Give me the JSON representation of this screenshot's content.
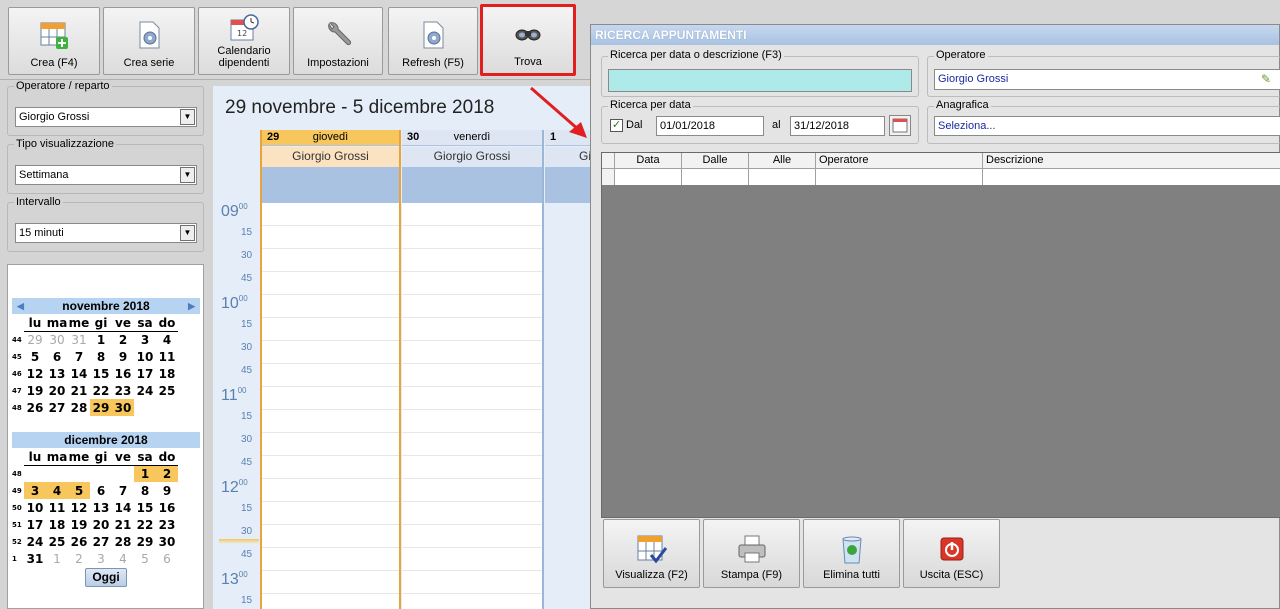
{
  "toolbar": {
    "buttons": [
      {
        "label": "Crea (F4)",
        "icon": "calendar-add-icon"
      },
      {
        "label": "Crea serie",
        "icon": "series-gear-icon"
      },
      {
        "label": "Calendario dipendenti",
        "icon": "calendar-clock-icon"
      },
      {
        "label": "Impostazioni",
        "icon": "wrench-icon"
      },
      {
        "label": "Refresh (F5)",
        "icon": "refresh-gear-icon"
      },
      {
        "label": "Trova",
        "icon": "binoculars-icon"
      }
    ]
  },
  "left": {
    "operator_label": "Operatore / reparto",
    "operator_value": "Giorgio Grossi",
    "view_label": "Tipo visualizzazione",
    "view_value": "Settimana",
    "interval_label": "Intervallo",
    "interval_value": "15 minuti",
    "today_label": "Oggi"
  },
  "minical": {
    "weekday_headers": [
      "lu",
      "ma",
      "me",
      "gi",
      "ve",
      "sa",
      "do"
    ],
    "november": {
      "title": "novembre 2018",
      "weeks": [
        {
          "wk": "44",
          "days": [
            "29",
            "30",
            "31",
            "1",
            "2",
            "3",
            "4"
          ]
        },
        {
          "wk": "45",
          "days": [
            "5",
            "6",
            "7",
            "8",
            "9",
            "10",
            "11"
          ]
        },
        {
          "wk": "46",
          "days": [
            "12",
            "13",
            "14",
            "15",
            "16",
            "17",
            "18"
          ]
        },
        {
          "wk": "47",
          "days": [
            "19",
            "20",
            "21",
            "22",
            "23",
            "24",
            "25"
          ]
        },
        {
          "wk": "48",
          "days": [
            "26",
            "27",
            "28",
            "29",
            "30",
            "",
            ""
          ]
        }
      ]
    },
    "december": {
      "title": "dicembre 2018",
      "weeks": [
        {
          "wk": "48",
          "days": [
            "",
            "",
            "",
            "",
            "",
            "1",
            "2"
          ]
        },
        {
          "wk": "49",
          "days": [
            "3",
            "4",
            "5",
            "6",
            "7",
            "8",
            "9"
          ]
        },
        {
          "wk": "50",
          "days": [
            "10",
            "11",
            "12",
            "13",
            "14",
            "15",
            "16"
          ]
        },
        {
          "wk": "51",
          "days": [
            "17",
            "18",
            "19",
            "20",
            "21",
            "22",
            "23"
          ]
        },
        {
          "wk": "52",
          "days": [
            "24",
            "25",
            "26",
            "27",
            "28",
            "29",
            "30"
          ]
        },
        {
          "wk": "1",
          "days": [
            "31",
            "1",
            "2",
            "3",
            "4",
            "5",
            "6"
          ]
        }
      ]
    }
  },
  "calendar": {
    "range_title": "29 novembre - 5 dicembre 2018",
    "days": [
      {
        "num": "29",
        "weekday": "giovedì",
        "resource": "Giorgio Grossi"
      },
      {
        "num": "30",
        "weekday": "venerdì",
        "resource": "Giorgio Grossi"
      },
      {
        "num": "1",
        "weekday": "",
        "resource": "Gi"
      }
    ],
    "hours": [
      "09",
      "10",
      "11",
      "12",
      "13"
    ],
    "hour_sup": "00",
    "minutes": [
      "15",
      "30",
      "45"
    ]
  },
  "dialog": {
    "title": "RICERCA APPUNTAMENTI",
    "search_label": "Ricerca per data o descrizione (F3)",
    "search_value": "",
    "operator_label": "Operatore",
    "operator_value": "Giorgio Grossi",
    "date_group_label": "Ricerca per data",
    "dal_label": "Dal",
    "dal_checked": true,
    "dal_value": "01/01/2018",
    "al_label": "al",
    "al_value": "31/12/2018",
    "anagrafica_label": "Anagrafica",
    "anagrafica_value": "Seleziona...",
    "columns": [
      "Data",
      "Dalle",
      "Alle",
      "Operatore",
      "Descrizione"
    ],
    "buttons": [
      {
        "label": "Visualizza (F2)",
        "icon": "calendar-check-icon"
      },
      {
        "label": "Stampa (F9)",
        "icon": "printer-icon"
      },
      {
        "label": "Elimina tutti",
        "icon": "recycle-bin-icon"
      },
      {
        "label": "Uscita (ESC)",
        "icon": "power-icon"
      }
    ]
  },
  "colors": {
    "highlight": "#f7c65c",
    "accent_blue": "#a9c2e1",
    "search_field": "#aeeaea",
    "selected_border": "#e02020"
  }
}
